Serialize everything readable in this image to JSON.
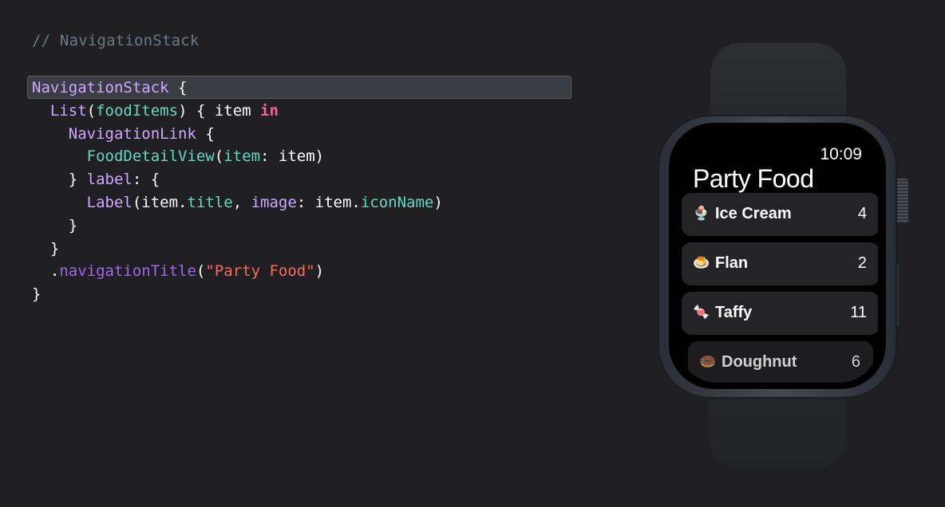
{
  "code": {
    "comment": "// NavigationStack",
    "lines": [
      [
        {
          "t": "type",
          "v": "NavigationStack"
        },
        {
          "t": "plain",
          "v": " {"
        }
      ],
      [
        {
          "t": "plain",
          "v": "  "
        },
        {
          "t": "type",
          "v": "List"
        },
        {
          "t": "plain",
          "v": "("
        },
        {
          "t": "var",
          "v": "foodItems"
        },
        {
          "t": "plain",
          "v": ") { item "
        },
        {
          "t": "kw",
          "v": "in"
        }
      ],
      [
        {
          "t": "plain",
          "v": "    "
        },
        {
          "t": "type",
          "v": "NavigationLink"
        },
        {
          "t": "plain",
          "v": " {"
        }
      ],
      [
        {
          "t": "plain",
          "v": "      "
        },
        {
          "t": "var",
          "v": "FoodDetailView"
        },
        {
          "t": "plain",
          "v": "("
        },
        {
          "t": "var",
          "v": "item"
        },
        {
          "t": "plain",
          "v": ": item)"
        }
      ],
      [
        {
          "t": "plain",
          "v": "    } "
        },
        {
          "t": "type",
          "v": "label"
        },
        {
          "t": "plain",
          "v": ": {"
        }
      ],
      [
        {
          "t": "plain",
          "v": "      "
        },
        {
          "t": "type",
          "v": "Label"
        },
        {
          "t": "plain",
          "v": "(item."
        },
        {
          "t": "var",
          "v": "title"
        },
        {
          "t": "plain",
          "v": ", "
        },
        {
          "t": "type",
          "v": "image"
        },
        {
          "t": "plain",
          "v": ": item."
        },
        {
          "t": "var",
          "v": "iconName"
        },
        {
          "t": "plain",
          "v": ")"
        }
      ],
      [
        {
          "t": "plain",
          "v": "    }"
        }
      ],
      [
        {
          "t": "plain",
          "v": "  }"
        }
      ],
      [
        {
          "t": "plain",
          "v": "  ."
        },
        {
          "t": "fn",
          "v": "navigationTitle"
        },
        {
          "t": "plain",
          "v": "("
        },
        {
          "t": "str",
          "v": "\"Party Food\""
        },
        {
          "t": "plain",
          "v": ")"
        }
      ],
      [
        {
          "t": "plain",
          "v": "}"
        }
      ]
    ]
  },
  "watch": {
    "time": "10:09",
    "nav_title": "Party Food",
    "items": [
      {
        "icon": "ice-cream-icon",
        "emoji": "🍨",
        "title": "Ice Cream",
        "count": "4"
      },
      {
        "icon": "flan-icon",
        "emoji": "🍮",
        "title": "Flan",
        "count": "2"
      },
      {
        "icon": "taffy-icon",
        "emoji": "🍬",
        "title": "Taffy",
        "count": "11"
      },
      {
        "icon": "doughnut-icon",
        "emoji": "🍩",
        "title": "Doughnut",
        "count": "6"
      }
    ]
  }
}
